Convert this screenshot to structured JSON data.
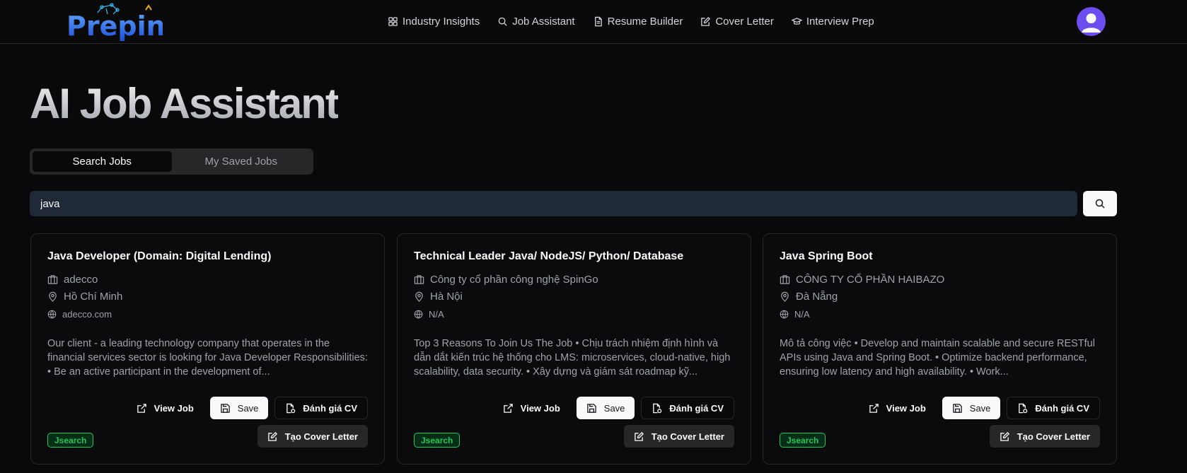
{
  "header": {
    "logo_text": "Prepin",
    "nav": [
      {
        "label": "Industry Insights",
        "icon": "dashboard-icon"
      },
      {
        "label": "Job Assistant",
        "icon": "search-icon"
      },
      {
        "label": "Resume Builder",
        "icon": "file-icon"
      },
      {
        "label": "Cover Letter",
        "icon": "edit-icon"
      },
      {
        "label": "Interview Prep",
        "icon": "graduation-cap-icon"
      }
    ]
  },
  "page": {
    "title": "AI Job Assistant",
    "tabs": [
      "Search Jobs",
      "My Saved Jobs"
    ],
    "active_tab": "Search Jobs"
  },
  "search": {
    "value": "java"
  },
  "jobs": [
    {
      "title": "Java Developer (Domain: Digital Lending)",
      "company": "adecco",
      "location": "Hồ Chí Minh",
      "website": "adecco.com",
      "description": "Our client - a leading technology company that operates in the financial services sector is looking for Java Developer Responsibilities: • Be an active participant in the development of...",
      "source": "Jsearch"
    },
    {
      "title": "Technical Leader Java/ NodeJS/ Python/ Database",
      "company": "Công ty cổ phần công nghệ SpinGo",
      "location": "Hà Nội",
      "website": "N/A",
      "description": "Top 3 Reasons To Join Us The Job • Chịu trách nhiệm định hình và dẫn dắt kiến trúc hệ thống cho LMS: microservices, cloud-native, high scalability, data security. • Xây dựng và giám sát roadmap kỹ...",
      "source": "Jsearch"
    },
    {
      "title": "Java Spring Boot",
      "company": "CÔNG TY CỔ PHẦN HAIBAZO",
      "location": "Đà Nẵng",
      "website": "N/A",
      "description": "Mô tả công việc • Develop and maintain scalable and secure RESTful APIs using Java and Spring Boot. • Optimize backend performance, ensuring low latency and high availability. • Work...",
      "source": "Jsearch"
    }
  ],
  "card_actions": {
    "view": "View Job",
    "save": "Save",
    "evaluate": "Đánh giá CV",
    "cover": "Tạo Cover Letter"
  },
  "colors": {
    "background": "#09090b",
    "accent_avatar": "#6d4df0",
    "badge_green": "#22c55e",
    "logo_blue": "#3b82f6"
  }
}
